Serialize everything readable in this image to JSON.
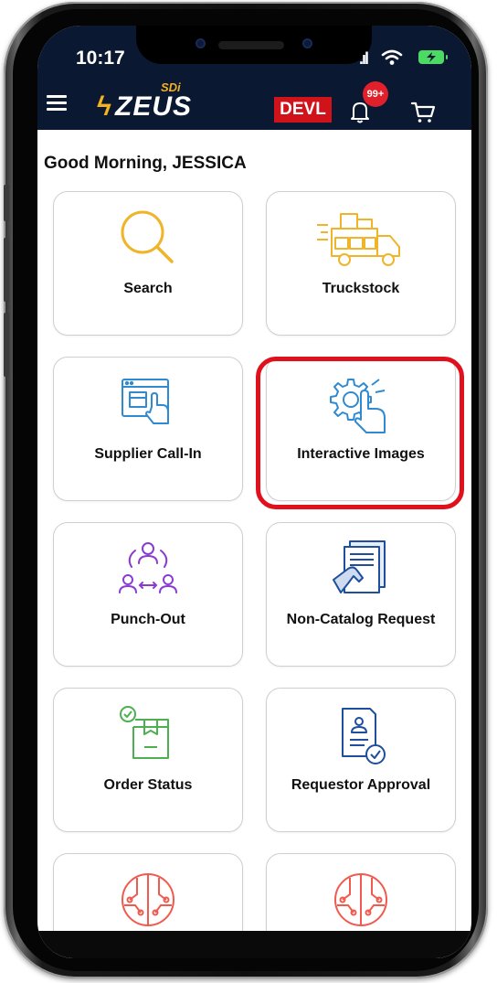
{
  "status": {
    "time": "10:17",
    "signal": ".ıl"
  },
  "header": {
    "brand": "ZEUS",
    "brand_super": "SDi",
    "env_badge": "DEVL",
    "notifications_badge": "99+"
  },
  "greeting": "Good Morning, JESSICA",
  "tiles": [
    {
      "label": "Search",
      "icon": "search-icon",
      "color": "#f0b429"
    },
    {
      "label": "Truckstock",
      "icon": "truck-icon",
      "color": "#f0b429"
    },
    {
      "label": "Supplier Call-In",
      "icon": "supplier-call-in-icon",
      "color": "#2f8ad1"
    },
    {
      "label": "Interactive Images",
      "icon": "gear-hand-icon",
      "color": "#2f8ad1"
    },
    {
      "label": "Punch-Out",
      "icon": "punch-out-users-icon",
      "color": "#8a3bd1"
    },
    {
      "label": "Non-Catalog Request",
      "icon": "catalog-hand-icon",
      "color": "#1e4f9c"
    },
    {
      "label": "Order Status",
      "icon": "order-box-icon",
      "color": "#4caf50"
    },
    {
      "label": "Requestor Approval",
      "icon": "approval-document-icon",
      "color": "#1e4f9c"
    },
    {
      "label": "",
      "icon": "circuit-icon",
      "color": "#f05a4f"
    },
    {
      "label": "",
      "icon": "circuit-icon",
      "color": "#f05a4f"
    }
  ]
}
